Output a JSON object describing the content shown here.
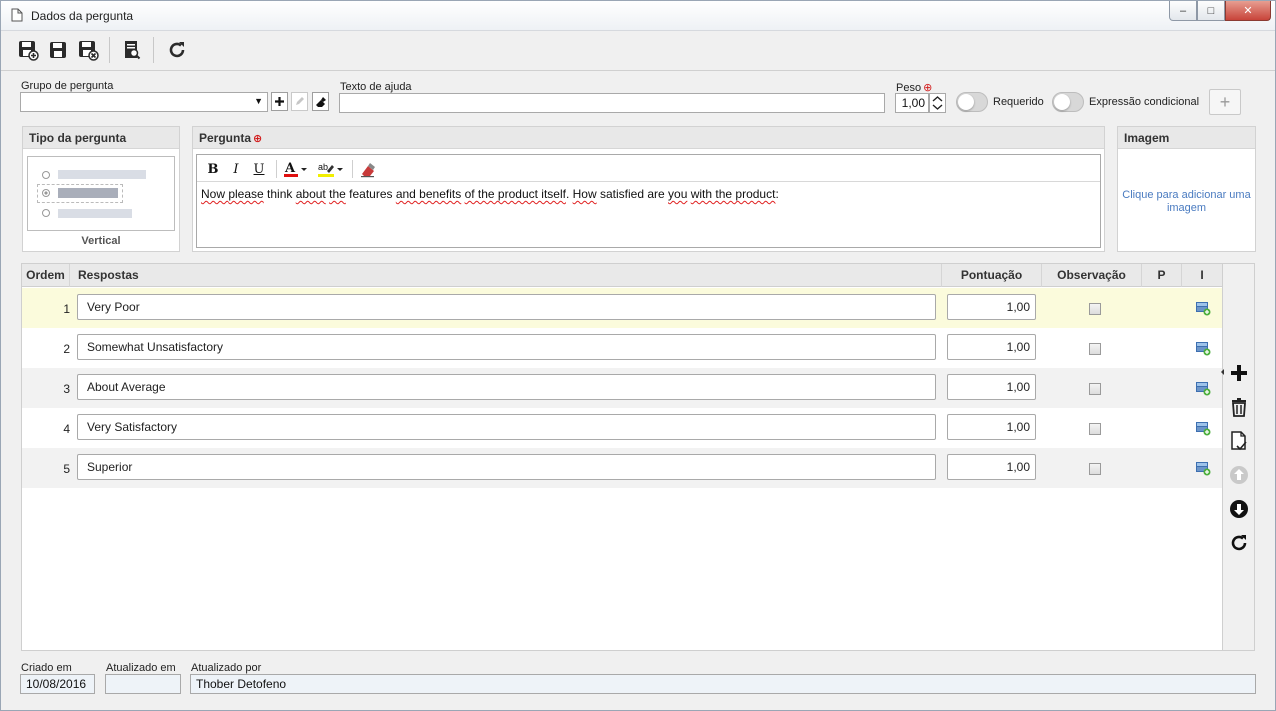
{
  "window": {
    "title": "Dados da pergunta",
    "controls": {
      "minimize": "–",
      "maximize": "□",
      "close": "✕"
    }
  },
  "toolbar": {
    "buttons": [
      "save-new-icon",
      "save-icon",
      "save-close-icon",
      "preview-icon",
      "refresh-icon"
    ]
  },
  "form": {
    "group_label": "Grupo de pergunta",
    "group_value": "",
    "help_label": "Texto de ajuda",
    "help_value": "",
    "weight_label": "Peso",
    "weight_value": "1,00",
    "required_label": "Requerido",
    "required_on": false,
    "conditional_label": "Expressão condicional",
    "conditional_on": false,
    "add_symbol": "+"
  },
  "question_type": {
    "title": "Tipo da pergunta",
    "layout_label": "Vertical"
  },
  "question": {
    "title": "Pergunta",
    "text_parts": [
      {
        "t": "Now ",
        "spell": true
      },
      {
        "t": "please",
        "spell": true
      },
      {
        "t": " think ",
        "spell": false
      },
      {
        "t": "about",
        "spell": true
      },
      {
        "t": " ",
        "spell": false
      },
      {
        "t": "the",
        "spell": true
      },
      {
        "t": " features ",
        "spell": false
      },
      {
        "t": "and benefits",
        "spell": true
      },
      {
        "t": " ",
        "spell": false
      },
      {
        "t": "of the product itself",
        "spell": true
      },
      {
        "t": ". ",
        "spell": false
      },
      {
        "t": "How",
        "spell": true
      },
      {
        "t": " satisfied are ",
        "spell": false
      },
      {
        "t": "you",
        "spell": true
      },
      {
        "t": " ",
        "spell": false
      },
      {
        "t": "with the product",
        "spell": true
      },
      {
        "t": ":",
        "spell": false
      }
    ]
  },
  "image": {
    "title": "Imagem",
    "placeholder": "Clique para adicionar uma imagem"
  },
  "answers": {
    "headers": {
      "order": "Ordem",
      "answers": "Respostas",
      "score": "Pontuação",
      "observation": "Observação",
      "p": "P",
      "i": "I"
    },
    "rows": [
      {
        "order": "1",
        "text": "Very Poor",
        "score": "1,00",
        "observation": false
      },
      {
        "order": "2",
        "text": "Somewhat Unsatisfactory",
        "score": "1,00",
        "observation": false
      },
      {
        "order": "3",
        "text": "About Average",
        "score": "1,00",
        "observation": false
      },
      {
        "order": "4",
        "text": "Very Satisfactory",
        "score": "1,00",
        "observation": false
      },
      {
        "order": "5",
        "text": "Superior",
        "score": "1,00",
        "observation": false
      }
    ]
  },
  "footer": {
    "created_label": "Criado em",
    "created_value": "10/08/2016",
    "updated_label": "Atualizado em",
    "updated_value": "",
    "updated_by_label": "Atualizado por",
    "updated_by_value": "Thober Detofeno"
  },
  "colors": {
    "selected_row": "#fbfbdc",
    "alt_row": "#f2f2f2",
    "required_marker": "#d21b1b",
    "link": "#4a7bc0"
  }
}
